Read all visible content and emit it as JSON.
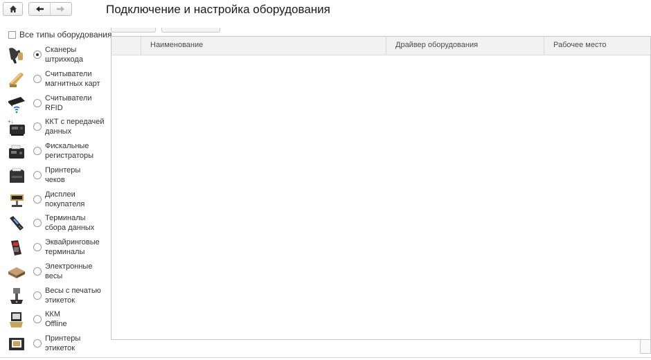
{
  "window": {
    "title": "Подключение и настройка оборудования"
  },
  "navigation": {
    "home_icon": "home-icon",
    "back_icon": "arrow-left-icon",
    "forward_icon": "arrow-right-icon"
  },
  "sidebar": {
    "all_types_label": "Все типы оборудования",
    "all_types_checked": false,
    "selected_index": 0,
    "items": [
      {
        "line1": "Сканеры",
        "line2": "штрихкода",
        "icon": "barcode-scanner-icon"
      },
      {
        "line1": "Считыватели",
        "line2": "магнитных карт",
        "icon": "magnetic-card-reader-icon"
      },
      {
        "line1": "Считыватели",
        "line2": "RFID",
        "icon": "rfid-reader-icon"
      },
      {
        "line1": "ККТ с передачей",
        "line2": "данных",
        "icon": "online-cash-register-icon"
      },
      {
        "line1": "Фискальные",
        "line2": "регистраторы",
        "icon": "fiscal-register-icon"
      },
      {
        "line1": "Принтеры",
        "line2": "чеков",
        "icon": "receipt-printer-icon"
      },
      {
        "line1": "Дисплеи",
        "line2": "покупателя",
        "icon": "customer-display-icon"
      },
      {
        "line1": "Терминалы",
        "line2": "сбора данных",
        "icon": "data-collection-terminal-icon"
      },
      {
        "line1": "Эквайринговые",
        "line2": "терминалы",
        "icon": "payment-terminal-icon"
      },
      {
        "line1": "Электронные",
        "line2": "весы",
        "icon": "electronic-scales-icon"
      },
      {
        "line1": "Весы с печатью",
        "line2": "этикеток",
        "icon": "label-scales-icon"
      },
      {
        "line1": "ККМ",
        "line2": "Offline",
        "icon": "offline-cash-register-icon"
      },
      {
        "line1": "Принтеры",
        "line2": "этикеток",
        "icon": "label-printer-icon"
      }
    ]
  },
  "grid": {
    "columns": [
      "Наименование",
      "Драйвер оборудования",
      "Рабочее место"
    ],
    "rows": []
  },
  "colors": {
    "header_bg": "#f2f2f2",
    "border": "#c8c8c8",
    "text": "#333333"
  }
}
